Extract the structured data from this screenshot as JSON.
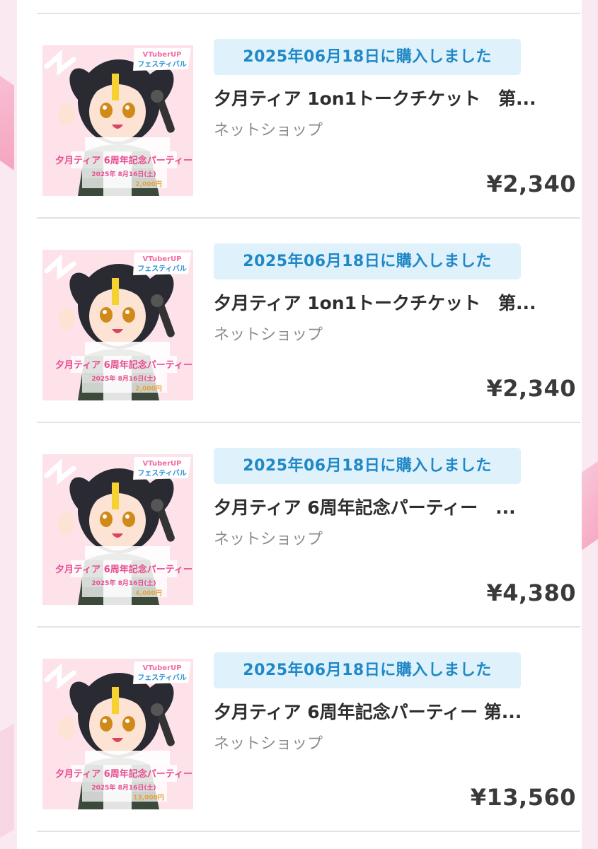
{
  "orders": [
    {
      "date_label": "2025年06月18日に購入しました",
      "title": "夕月ティア 1on1トークチケット　第...",
      "shop": "ネットショップ",
      "price": "¥2,340",
      "thumb": {
        "badge": "VTuberUP",
        "badge2": "フェスティバル",
        "event": "夕月ティア 6周年記念パーティー",
        "event_date": "2025年 8月16日(土)",
        "ticket": "2,000円"
      }
    },
    {
      "date_label": "2025年06月18日に購入しました",
      "title": "夕月ティア 1on1トークチケット　第...",
      "shop": "ネットショップ",
      "price": "¥2,340",
      "thumb": {
        "badge": "VTuberUP",
        "badge2": "フェスティバル",
        "event": "夕月ティア 6周年記念パーティー",
        "event_date": "2025年 8月16日(土)",
        "ticket": "2,000円"
      }
    },
    {
      "date_label": "2025年06月18日に購入しました",
      "title": "夕月ティア 6周年記念パーティー　...",
      "shop": "ネットショップ",
      "price": "¥4,380",
      "thumb": {
        "badge": "VTuberUP",
        "badge2": "フェスティバル",
        "event": "夕月ティア 6周年記念パーティー",
        "event_date": "2025年 8月16日(土)",
        "ticket": "4,000円"
      }
    },
    {
      "date_label": "2025年06月18日に購入しました",
      "title": "夕月ティア 6周年記念パーティー 第...",
      "shop": "ネットショップ",
      "price": "¥13,560",
      "thumb": {
        "badge": "VTuberUP",
        "badge2": "フェスティバル",
        "event": "夕月ティア 6周年記念パーティー",
        "event_date": "2025年 8月16日(土)",
        "ticket": "13,000円"
      }
    }
  ],
  "colors": {
    "badge_bg": "#dff1fb",
    "badge_text": "#1f88c6",
    "title_text": "#2e2e2e",
    "shop_text": "#8c8c8c",
    "page_bg": "#fbe9f1"
  }
}
